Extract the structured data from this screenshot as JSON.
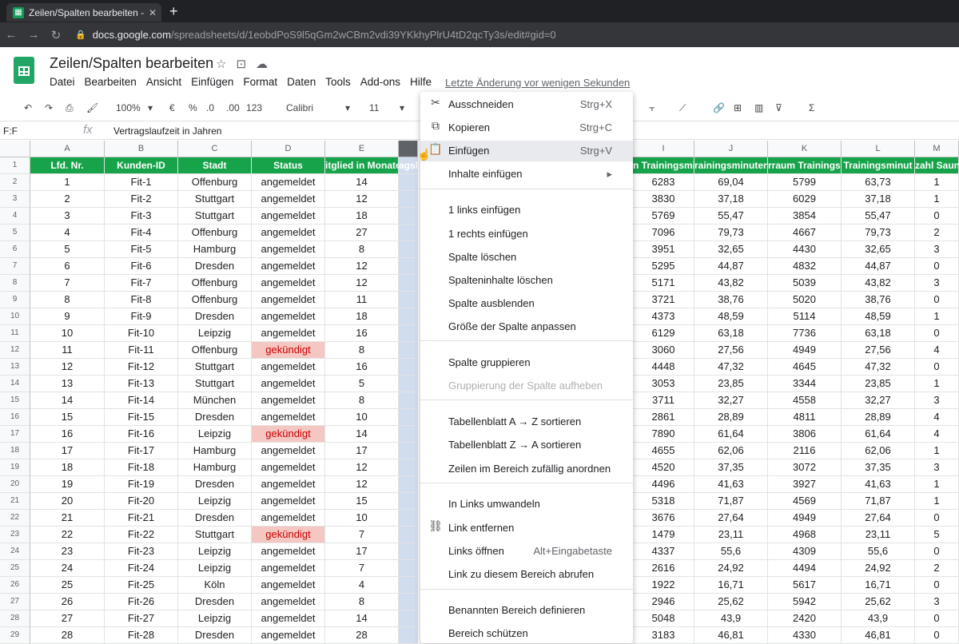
{
  "browser": {
    "tab_title": "Zeilen/Spalten bearbeiten - Goo",
    "tab_close": "✕",
    "new_tab": "+",
    "url_host": "docs.google.com",
    "url_path": "/spreadsheets/d/1eobdPoS9l5qGm2wCBm2vdi39YKkhyPlrU4tD2qcTy3s/edit#gid=0"
  },
  "app": {
    "title": "Zeilen/Spalten bearbeiten",
    "menus": [
      "Datei",
      "Bearbeiten",
      "Ansicht",
      "Einfügen",
      "Format",
      "Daten",
      "Tools",
      "Add-ons",
      "Hilfe"
    ],
    "last_edit": "Letzte Änderung vor wenigen Sekunden"
  },
  "toolbar": {
    "zoom": "100%",
    "currency": "€",
    "percent": "%",
    "dec_less": ".0",
    "dec_more": ".00",
    "format": "123",
    "font": "Calibri",
    "size": "11"
  },
  "formula": {
    "namebox": "F:F",
    "fx": "fx",
    "content": "Vertragslaufzeit in Jahren"
  },
  "grid": {
    "left_columns": [
      "A",
      "B",
      "C",
      "D",
      "E",
      "F"
    ],
    "right_columns": [
      "I",
      "J",
      "K",
      "L",
      "M"
    ],
    "left_headers": [
      "Lfd. Nr.",
      "Kunden-ID",
      "Stadt",
      "Status",
      "itglied in Monate",
      "agslı"
    ],
    "right_headers": [
      "n Trainingsmi",
      "rainingsminuten",
      "rraum Trainingsm",
      "Trainingsminut",
      "zahl Saun"
    ],
    "rows": [
      [
        "1",
        "Fit-1",
        "Offenburg",
        "angemeldet",
        "14",
        "6283",
        "69,04",
        "5799",
        "63,73",
        "1"
      ],
      [
        "2",
        "Fit-2",
        "Stuttgart",
        "angemeldet",
        "12",
        "3830",
        "37,18",
        "6029",
        "37,18",
        "1"
      ],
      [
        "3",
        "Fit-3",
        "Stuttgart",
        "angemeldet",
        "18",
        "5769",
        "55,47",
        "3854",
        "55,47",
        "0"
      ],
      [
        "4",
        "Fit-4",
        "Offenburg",
        "angemeldet",
        "27",
        "7096",
        "79,73",
        "4667",
        "79,73",
        "2"
      ],
      [
        "5",
        "Fit-5",
        "Hamburg",
        "angemeldet",
        "8",
        "3951",
        "32,65",
        "4430",
        "32,65",
        "3"
      ],
      [
        "6",
        "Fit-6",
        "Dresden",
        "angemeldet",
        "12",
        "5295",
        "44,87",
        "4832",
        "44,87",
        "0"
      ],
      [
        "7",
        "Fit-7",
        "Offenburg",
        "angemeldet",
        "12",
        "5171",
        "43,82",
        "5039",
        "43,82",
        "3"
      ],
      [
        "8",
        "Fit-8",
        "Offenburg",
        "angemeldet",
        "11",
        "3721",
        "38,76",
        "5020",
        "38,76",
        "0"
      ],
      [
        "9",
        "Fit-9",
        "Dresden",
        "angemeldet",
        "18",
        "4373",
        "48,59",
        "5114",
        "48,59",
        "1"
      ],
      [
        "10",
        "Fit-10",
        "Leipzig",
        "angemeldet",
        "16",
        "6129",
        "63,18",
        "7736",
        "63,18",
        "0"
      ],
      [
        "11",
        "Fit-11",
        "Offenburg",
        "gekündigt",
        "8",
        "3060",
        "27,56",
        "4949",
        "27,56",
        "4"
      ],
      [
        "12",
        "Fit-12",
        "Stuttgart",
        "angemeldet",
        "16",
        "4448",
        "47,32",
        "4645",
        "47,32",
        "0"
      ],
      [
        "13",
        "Fit-13",
        "Stuttgart",
        "angemeldet",
        "5",
        "3053",
        "23,85",
        "3344",
        "23,85",
        "1"
      ],
      [
        "14",
        "Fit-14",
        "München",
        "angemeldet",
        "8",
        "3711",
        "32,27",
        "4558",
        "32,27",
        "3"
      ],
      [
        "15",
        "Fit-15",
        "Dresden",
        "angemeldet",
        "10",
        "2861",
        "28,89",
        "4811",
        "28,89",
        "4"
      ],
      [
        "16",
        "Fit-16",
        "Leipzig",
        "gekündigt",
        "14",
        "7890",
        "61,64",
        "3806",
        "61,64",
        "4"
      ],
      [
        "17",
        "Fit-17",
        "Hamburg",
        "angemeldet",
        "17",
        "4655",
        "62,06",
        "2116",
        "62,06",
        "1"
      ],
      [
        "18",
        "Fit-18",
        "Hamburg",
        "angemeldet",
        "12",
        "4520",
        "37,35",
        "3072",
        "37,35",
        "3"
      ],
      [
        "19",
        "Fit-19",
        "Dresden",
        "angemeldet",
        "12",
        "4496",
        "41,63",
        "3927",
        "41,63",
        "1"
      ],
      [
        "20",
        "Fit-20",
        "Leipzig",
        "angemeldet",
        "15",
        "5318",
        "71,87",
        "4569",
        "71,87",
        "1"
      ],
      [
        "21",
        "Fit-21",
        "Dresden",
        "angemeldet",
        "10",
        "3676",
        "27,64",
        "4949",
        "27,64",
        "0"
      ],
      [
        "22",
        "Fit-22",
        "Stuttgart",
        "gekündigt",
        "7",
        "1479",
        "23,11",
        "4968",
        "23,11",
        "5"
      ],
      [
        "23",
        "Fit-23",
        "Leipzig",
        "angemeldet",
        "17",
        "4337",
        "55,6",
        "4309",
        "55,6",
        "0"
      ],
      [
        "24",
        "Fit-24",
        "Leipzig",
        "angemeldet",
        "7",
        "2616",
        "24,92",
        "4494",
        "24,92",
        "2"
      ],
      [
        "25",
        "Fit-25",
        "Köln",
        "angemeldet",
        "4",
        "1922",
        "16,71",
        "5617",
        "16,71",
        "0"
      ],
      [
        "26",
        "Fit-26",
        "Dresden",
        "angemeldet",
        "8",
        "2946",
        "25,62",
        "5942",
        "25,62",
        "3"
      ],
      [
        "27",
        "Fit-27",
        "Leipzig",
        "angemeldet",
        "14",
        "5048",
        "43,9",
        "2420",
        "43,9",
        "0"
      ],
      [
        "28",
        "Fit-28",
        "Dresden",
        "angemeldet",
        "28",
        "3183",
        "46,81",
        "4330",
        "46,81",
        "0"
      ]
    ]
  },
  "context_menu": {
    "items": [
      {
        "icon": "✂",
        "label": "Ausschneiden",
        "shortcut": "Strg+X"
      },
      {
        "icon": "⧉",
        "label": "Kopieren",
        "shortcut": "Strg+C"
      },
      {
        "icon": "📋",
        "label": "Einfügen",
        "shortcut": "Strg+V"
      },
      {
        "icon": "",
        "label": "Inhalte einfügen",
        "shortcut": "▸"
      },
      {
        "icon": "",
        "label": "1 links einfügen",
        "shortcut": ""
      },
      {
        "icon": "",
        "label": "1 rechts einfügen",
        "shortcut": ""
      },
      {
        "icon": "",
        "label": "Spalte löschen",
        "shortcut": ""
      },
      {
        "icon": "",
        "label": "Spalteninhalte löschen",
        "shortcut": ""
      },
      {
        "icon": "",
        "label": "Spalte ausblenden",
        "shortcut": ""
      },
      {
        "icon": "",
        "label": "Größe der Spalte anpassen",
        "shortcut": ""
      },
      {
        "icon": "",
        "label": "Spalte gruppieren",
        "shortcut": ""
      },
      {
        "icon": "",
        "label": "Gruppierung der Spalte aufheben",
        "shortcut": ""
      },
      {
        "icon": "",
        "label": "Tabellenblatt A → Z sortieren",
        "shortcut": ""
      },
      {
        "icon": "",
        "label": "Tabellenblatt Z → A sortieren",
        "shortcut": ""
      },
      {
        "icon": "",
        "label": "Zeilen im Bereich zufällig anordnen",
        "shortcut": ""
      },
      {
        "icon": "",
        "label": "In Links umwandeln",
        "shortcut": ""
      },
      {
        "icon": "⛓",
        "label": "Link entfernen",
        "shortcut": ""
      },
      {
        "icon": "",
        "label": "Links öffnen",
        "shortcut": "Alt+Eingabetaste"
      },
      {
        "icon": "",
        "label": "Link zu diesem Bereich abrufen",
        "shortcut": ""
      },
      {
        "icon": "",
        "label": "Benannten Bereich definieren",
        "shortcut": ""
      },
      {
        "icon": "",
        "label": "Bereich schützen",
        "shortcut": ""
      }
    ]
  },
  "colors": {
    "header_green": "#17a34a",
    "cancelled_bg": "#f4c7c3",
    "cancelled_text": "#cc0000"
  }
}
